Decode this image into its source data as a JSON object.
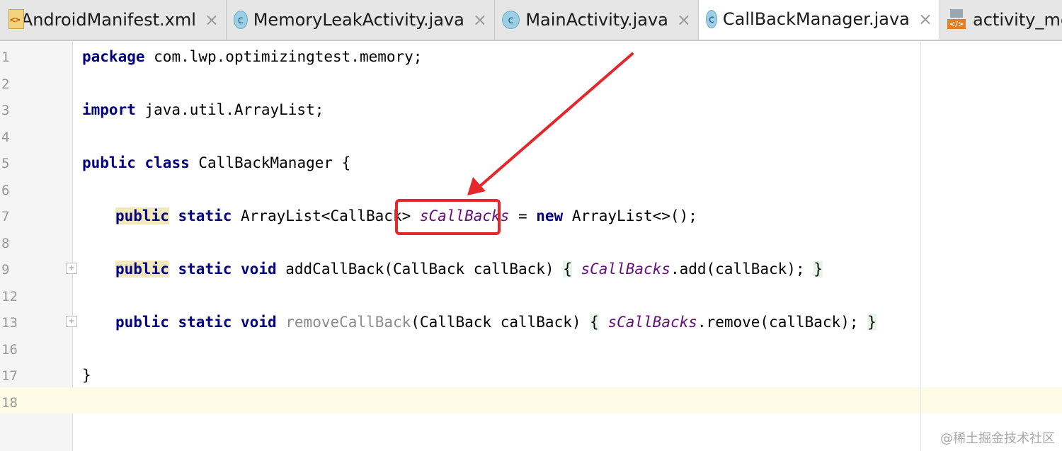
{
  "tabs": [
    {
      "label": "AndroidManifest.xml",
      "icon": "xml-file-icon",
      "active": false
    },
    {
      "label": "MemoryLeakActivity.java",
      "icon": "class-c-icon",
      "active": false
    },
    {
      "label": "MainActivity.java",
      "icon": "class-c-icon",
      "active": false
    },
    {
      "label": "CallBackManager.java",
      "icon": "class-c-icon",
      "active": true
    },
    {
      "label": "activity_me",
      "icon": "layout-file-icon",
      "active": false
    }
  ],
  "close_glyph": "×",
  "class_icon_letter": "c",
  "line_numbers": [
    "1",
    "2",
    "3",
    "4",
    "5",
    "6",
    "7",
    "8",
    "9",
    "12",
    "13",
    "16",
    "17",
    "18"
  ],
  "code": {
    "l1": {
      "kw": "package",
      "rest": " com.lwp.optimizingtest.memory;"
    },
    "l3": {
      "kw": "import",
      "rest": " java.util.ArrayList;"
    },
    "l5": {
      "kw1": "public",
      "kw2": "class",
      "rest": " CallBackManager {"
    },
    "l7": {
      "kw1": "public",
      "kw2": "static",
      "type": " ArrayList<CallBack> ",
      "field": "sCallBacks",
      "eq": " = ",
      "kw3": "new",
      "rest": " ArrayList<>();"
    },
    "l9": {
      "kw1": "public",
      "kw2": "static",
      "kw3": "void",
      "sig": " addCallBack(CallBack callBack) ",
      "open": "{",
      "field": "sCallBacks",
      "call": ".add(callBack);",
      "close": "}"
    },
    "l13": {
      "kw1": "public",
      "kw2": "static",
      "kw3": "void",
      "method": "removeCallBack",
      "params": "(CallBack callBack) ",
      "open": "{",
      "field": "sCallBacks",
      "call": ".remove(callBack);",
      "close": "}"
    },
    "l17": {
      "close": "}"
    }
  },
  "fold_glyph": "+",
  "watermark": "@稀土掘金技术社区",
  "colors": {
    "keyword": "#000080",
    "field": "#660e7a",
    "annotation": "#e5262b"
  }
}
